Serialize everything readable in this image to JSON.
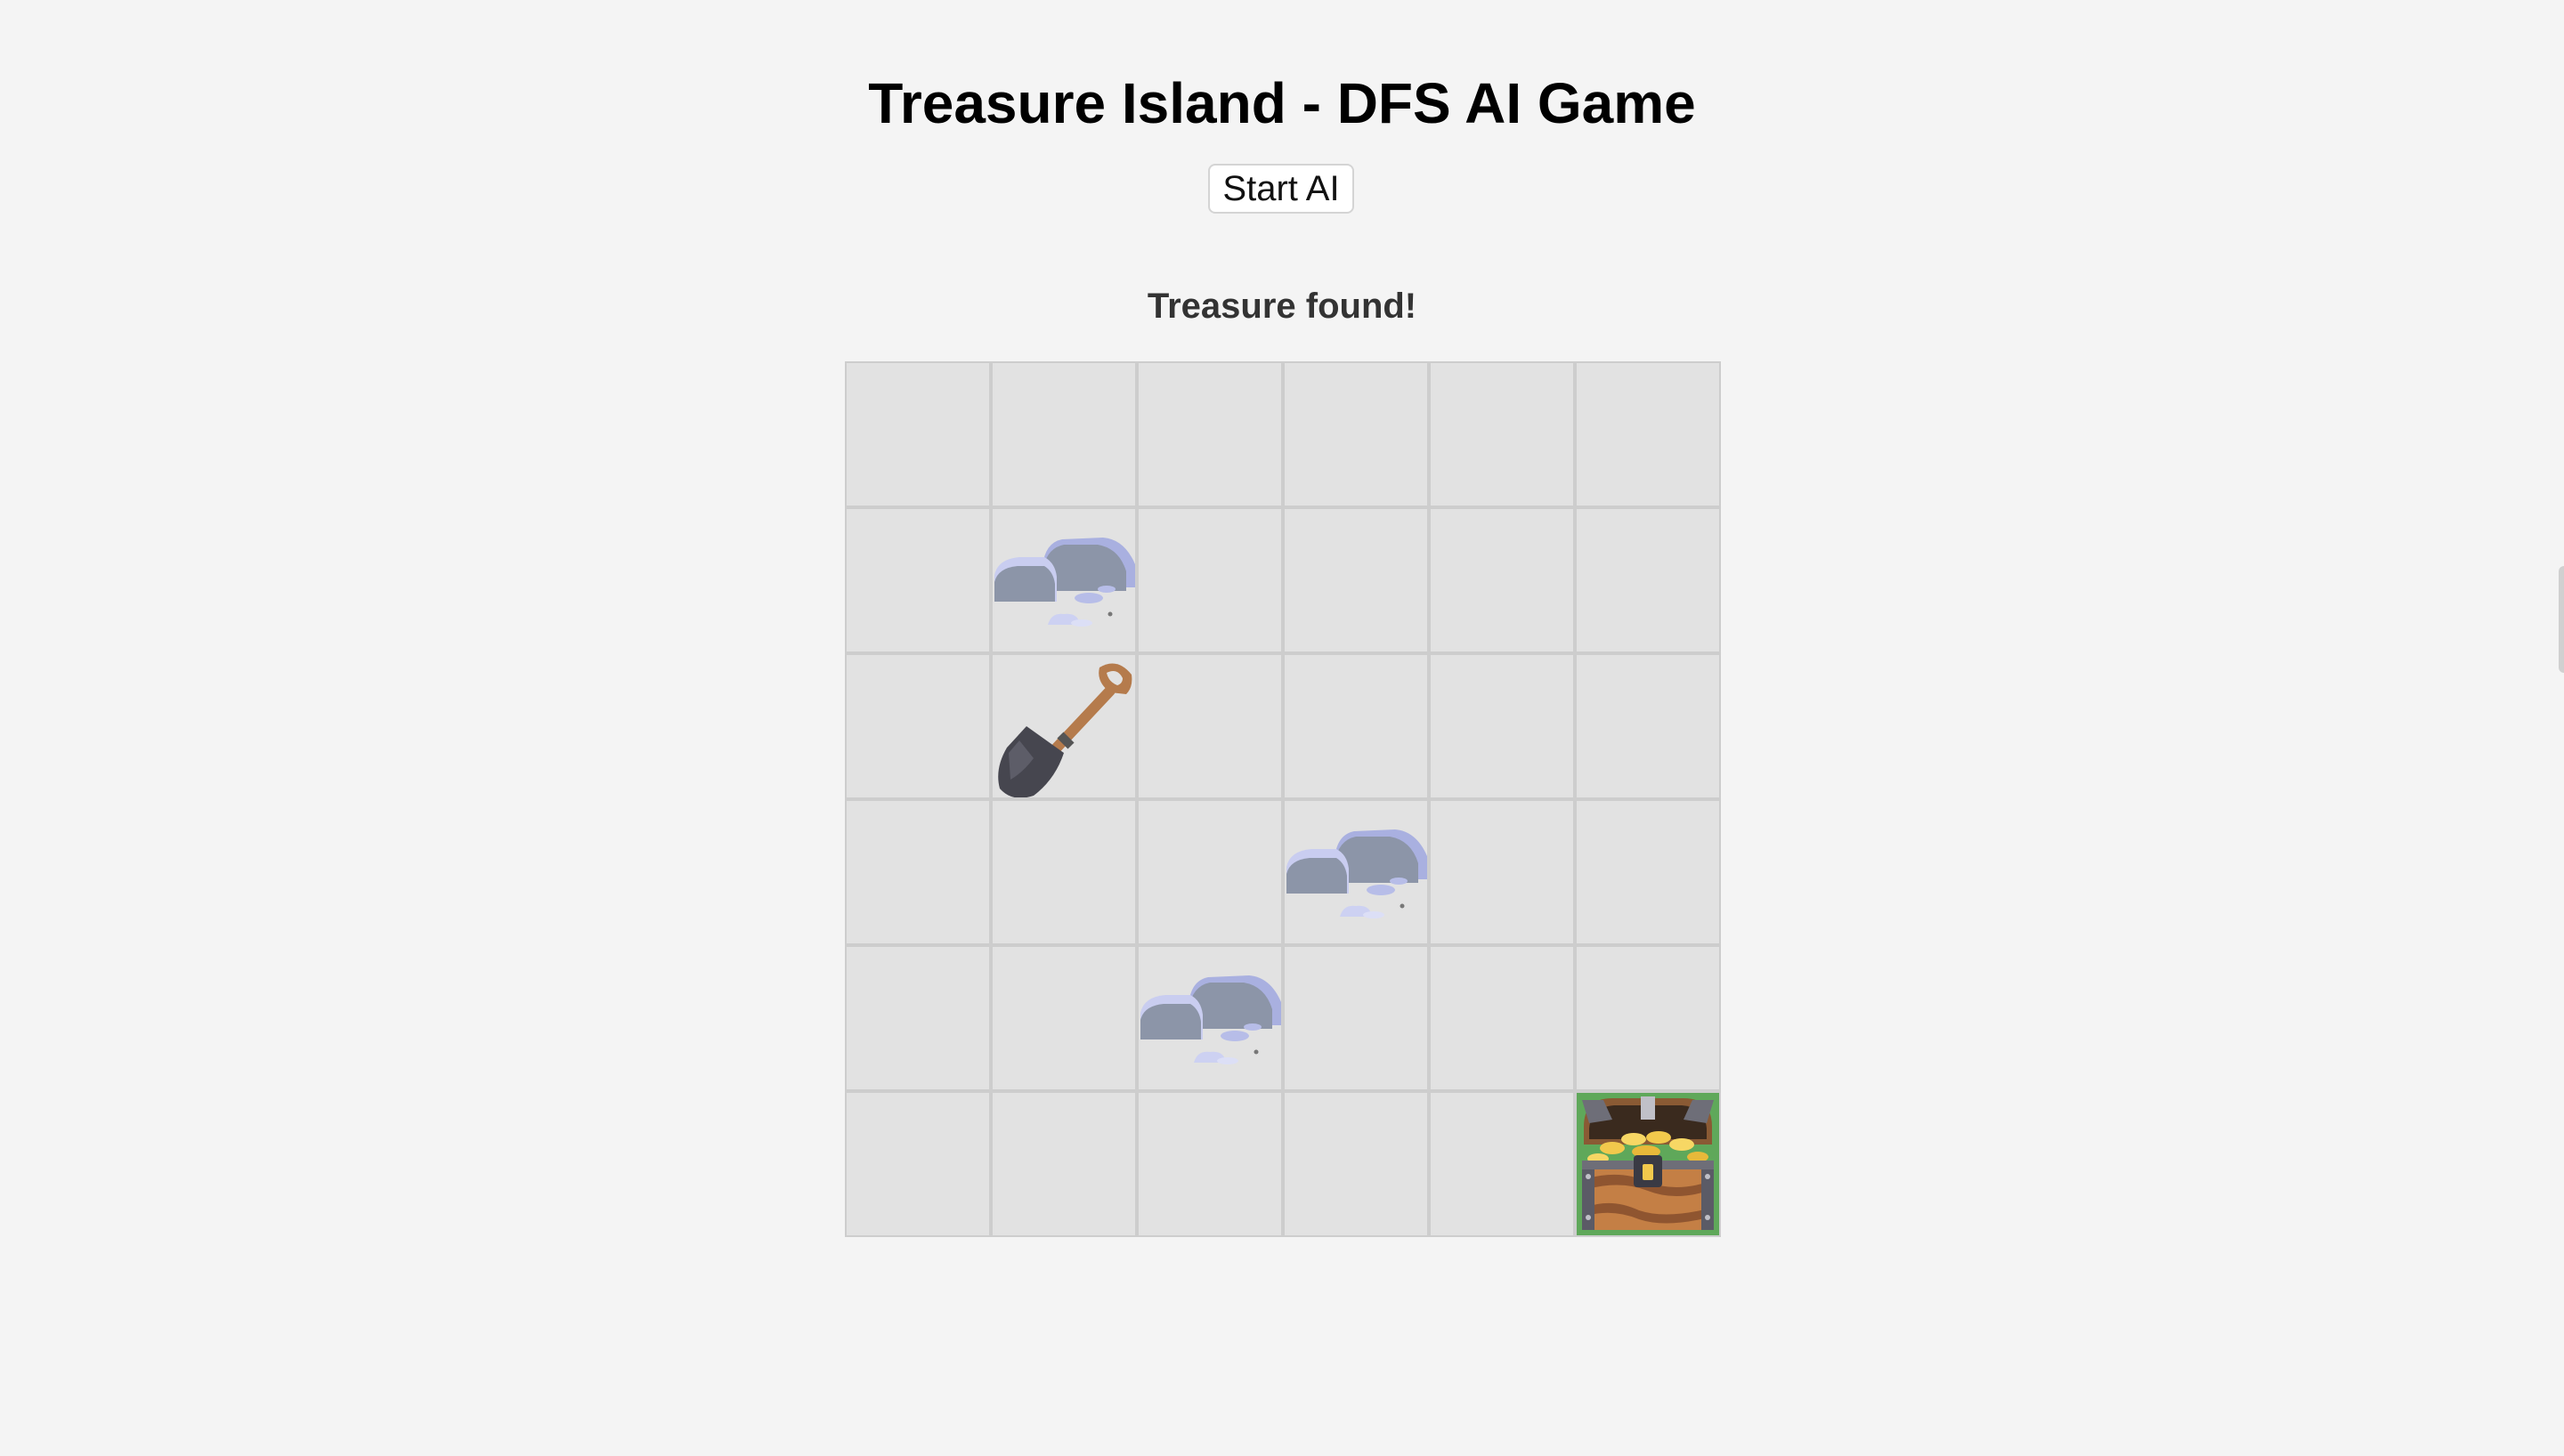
{
  "title": "Treasure Island - DFS AI Game",
  "controls": {
    "start_label": "Start AI"
  },
  "status": "Treasure found!",
  "board": {
    "rows": 6,
    "cols": 6,
    "cells": [
      [
        "empty",
        "empty",
        "empty",
        "empty",
        "empty",
        "empty"
      ],
      [
        "empty",
        "rock",
        "empty",
        "empty",
        "empty",
        "empty"
      ],
      [
        "empty",
        "shovel",
        "empty",
        "empty",
        "empty",
        "empty"
      ],
      [
        "empty",
        "empty",
        "empty",
        "rock",
        "empty",
        "empty"
      ],
      [
        "empty",
        "empty",
        "rock",
        "empty",
        "empty",
        "empty"
      ],
      [
        "empty",
        "empty",
        "empty",
        "empty",
        "empty",
        "treasure"
      ]
    ]
  },
  "icons": {
    "rock": "rock-icon",
    "shovel": "shovel-icon",
    "treasure": "treasure-chest-icon"
  },
  "colors": {
    "background": "#f4f4f4",
    "cell": "#e2e2e2",
    "cell_border": "#cdcdcd",
    "goal_cell": "#5fa85a"
  }
}
